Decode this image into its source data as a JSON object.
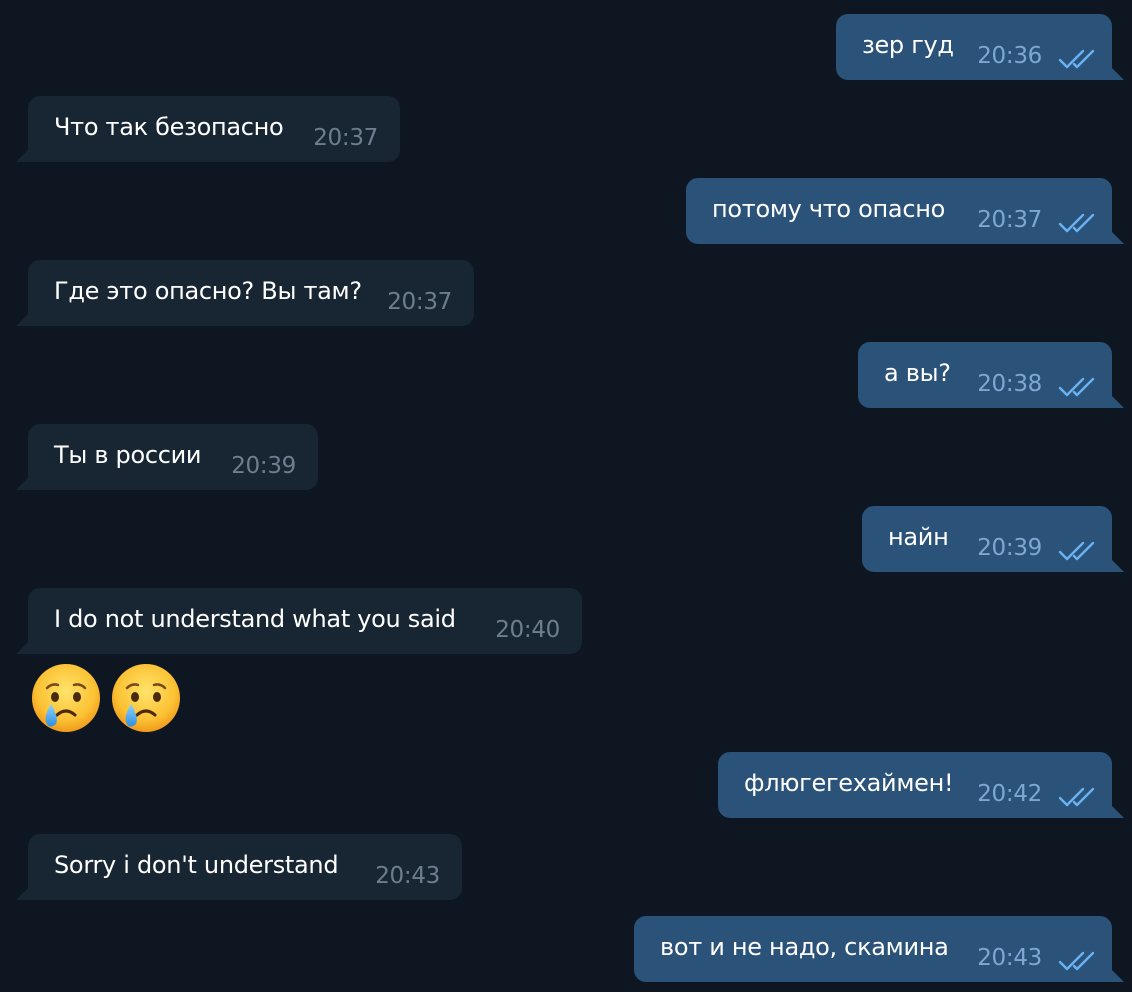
{
  "colors": {
    "background": "#0e1621",
    "incoming_bubble": "#182533",
    "outgoing_bubble": "#2b5278",
    "outgoing_time": "#7da8d3",
    "incoming_time": "#6d7f8f",
    "read_ticks": "#6ab2f2"
  },
  "messages": [
    {
      "direction": "out",
      "text": "зер гуд",
      "time": "20:36",
      "status_icon": "double-check-icon"
    },
    {
      "direction": "in",
      "text": "Что так безопасно",
      "time": "20:37"
    },
    {
      "direction": "out",
      "text": "потому что опасно",
      "time": "20:37",
      "status_icon": "double-check-icon"
    },
    {
      "direction": "in",
      "text": "Где это опасно? Вы там?",
      "time": "20:37"
    },
    {
      "direction": "out",
      "text": "а вы?",
      "time": "20:38",
      "status_icon": "double-check-icon"
    },
    {
      "direction": "in",
      "text": "Ты в россии",
      "time": "20:39"
    },
    {
      "direction": "out",
      "text": "найн",
      "time": "20:39",
      "status_icon": "double-check-icon"
    },
    {
      "direction": "in",
      "text": "I do not understand what you said",
      "time": "20:40"
    },
    {
      "direction": "out",
      "text": "флюгегехаймен!",
      "time": "20:42",
      "status_icon": "double-check-icon"
    },
    {
      "direction": "in",
      "text": "Sorry i don't understand",
      "time": "20:43"
    },
    {
      "direction": "out",
      "text": "вот и не надо, скамина",
      "time": "20:43",
      "status_icon": "double-check-icon"
    }
  ],
  "emoji_message": {
    "direction": "in",
    "emojis": [
      "crying-face-emoji",
      "crying-face-emoji"
    ]
  }
}
